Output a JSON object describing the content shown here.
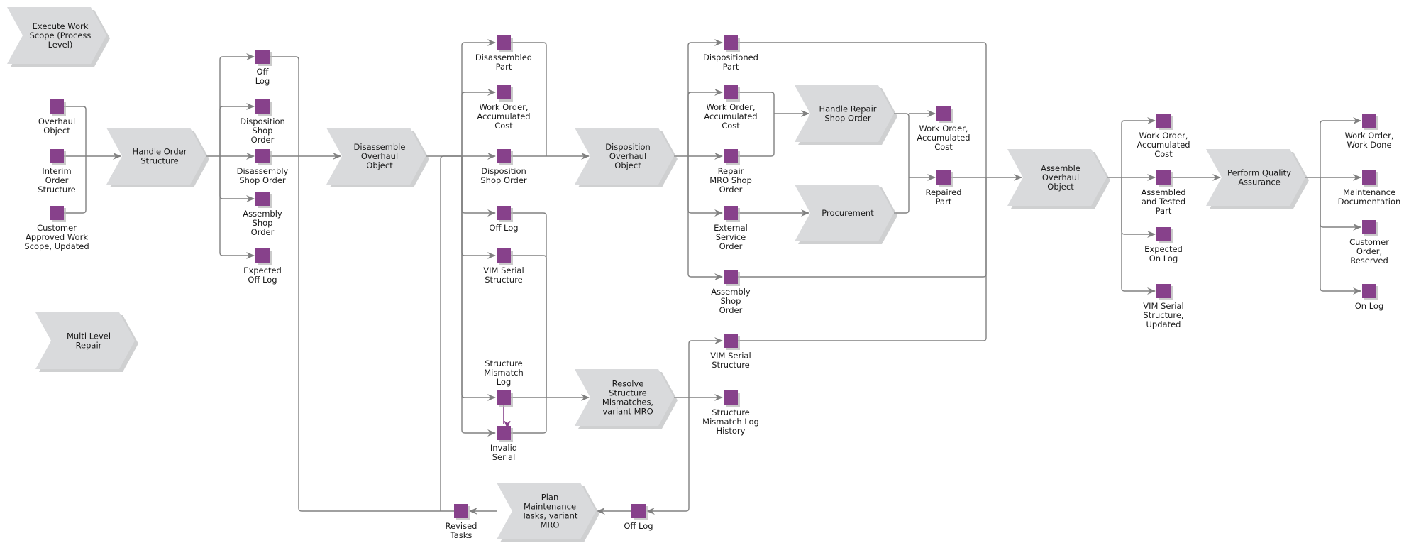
{
  "diagram": {
    "type": "process-chain",
    "colors": {
      "function_fill": "#d9dadc",
      "object_fill": "#87418b",
      "connector": "#808080"
    },
    "functions": {
      "execute_work_scope": [
        "Execute Work",
        "Scope (Process",
        "Level)"
      ],
      "multi_level_repair": [
        "Multi Level",
        "Repair"
      ],
      "handle_order_structure": [
        "Handle Order",
        "Structure"
      ],
      "disassemble_overhaul_object": [
        "Disassemble",
        "Overhaul",
        "Object"
      ],
      "disposition_overhaul_object": [
        "Disposition",
        "Overhaul",
        "Object"
      ],
      "handle_repair_shop_order": [
        "Handle Repair",
        "Shop Order"
      ],
      "procurement": [
        "Procurement"
      ],
      "assemble_overhaul_object": [
        "Assemble",
        "Overhaul",
        "Object"
      ],
      "perform_quality_assurance": [
        "Perform Quality",
        "Assurance"
      ],
      "resolve_structure_mismatches": [
        "Resolve",
        "Structure",
        "Mismatches,",
        "variant MRO"
      ],
      "plan_maintenance_tasks": [
        "Plan",
        "Maintenance",
        "Tasks, variant",
        "MRO"
      ]
    },
    "objects": {
      "overhaul_object": [
        "Overhaul",
        "Object"
      ],
      "interim_order_structure": [
        "Interim",
        "Order",
        "Structure"
      ],
      "customer_approved_work_scope": [
        "Customer",
        "Approved Work",
        "Scope, Updated"
      ],
      "c2_off_log": [
        "Off",
        "Log"
      ],
      "c2_disposition_shop_order": [
        "Disposition",
        "Shop",
        "Order"
      ],
      "c2_disassembly_shop_order": [
        "Disassembly",
        "Shop Order"
      ],
      "c2_assembly_shop_order": [
        "Assembly",
        "Shop",
        "Order"
      ],
      "c2_expected_off_log": [
        "Expected",
        "Off Log"
      ],
      "c3_disassembled_part": [
        "Disassembled",
        "Part"
      ],
      "c3_work_order_accumulated_cost": [
        "Work Order,",
        "Accumulated",
        "Cost"
      ],
      "c3_disposition_shop_order": [
        "Disposition",
        "Shop Order"
      ],
      "c3_off_log": [
        "Off Log"
      ],
      "c3_vim_serial_structure": [
        "VIM Serial",
        "Structure"
      ],
      "c3_structure_mismatch_log": [
        "Structure",
        "Mismatch",
        "Log"
      ],
      "c3_invalid_serial": [
        "Invalid",
        "Serial"
      ],
      "c4_dispositioned_part": [
        "Dispositioned",
        "Part"
      ],
      "c4_work_order_accumulated_cost": [
        "Work Order,",
        "Accumulated",
        "Cost"
      ],
      "c4_repair_mro_shop_order": [
        "Repair",
        "MRO Shop",
        "Order"
      ],
      "c4_external_service_order": [
        "External",
        "Service",
        "Order"
      ],
      "c4_assembly_shop_order": [
        "Assembly",
        "Shop",
        "Order"
      ],
      "c4_vim_serial_structure": [
        "VIM Serial",
        "Structure"
      ],
      "c4_structure_mismatch_log_history": [
        "Structure",
        "Mismatch Log",
        "History"
      ],
      "c5_work_order_accumulated_cost": [
        "Work Order,",
        "Accumulated",
        "Cost"
      ],
      "c5_repaired_part": [
        "Repaired",
        "Part"
      ],
      "c6_work_order_accumulated_cost": [
        "Work Order,",
        "Accumulated",
        "Cost"
      ],
      "c6_assembled_and_tested_part": [
        "Assembled",
        "and Tested",
        "Part"
      ],
      "c6_expected_on_log": [
        "Expected",
        "On Log"
      ],
      "c6_vim_serial_structure_updated": [
        "VIM Serial",
        "Structure,",
        "Updated"
      ],
      "c7_work_order_work_done": [
        "Work Order,",
        "Work Done"
      ],
      "c7_maintenance_documentation": [
        "Maintenance",
        "Documentation"
      ],
      "c7_customer_order_reserved": [
        "Customer",
        "Order,",
        "Reserved"
      ],
      "c7_on_log": [
        "On Log"
      ],
      "b_off_log": [
        "Off Log"
      ],
      "b_revised_tasks": [
        "Revised",
        "Tasks"
      ]
    }
  }
}
